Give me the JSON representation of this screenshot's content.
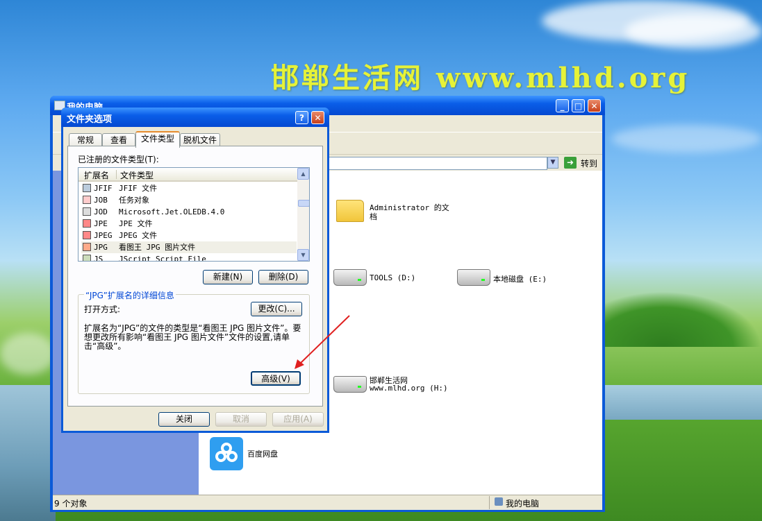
{
  "desktop": {
    "watermark": "邯郸生活网  www.mlhd.org",
    "side_labels": [
      "",
      "",
      "",
      ""
    ]
  },
  "main_window": {
    "title": "我的电脑",
    "address_go": "转到",
    "status_count": "9 个对象",
    "status_location": "我的电脑",
    "items": [
      {
        "name": "Administrator 的文档",
        "line1": "Administrator 的文",
        "line2": "档",
        "icon": "folder-icon"
      },
      {
        "name": "TOOLS (D:)",
        "line1": "TOOLS (D:)",
        "icon": "drive-icon"
      },
      {
        "name": "本地磁盘 (E:)",
        "line1": "本地磁盘 (E:)",
        "icon": "drive-icon"
      },
      {
        "name": "邯郸生活网 www.mlhd.org (H:)",
        "line1": "邯郸生活网",
        "line2": "www.mlhd.org (H:)",
        "icon": "drive-icon"
      },
      {
        "name": "百度网盘",
        "line1": "百度网盘",
        "icon": "baidu-icon"
      }
    ]
  },
  "dialog": {
    "title": "文件夹选项",
    "help_glyph": "?",
    "close_glyph": "✕",
    "tabs": [
      "常规",
      "查看",
      "文件类型",
      "脱机文件"
    ],
    "active_tab": "文件类型",
    "registered_label": "已注册的文件类型(T):",
    "columns": [
      "扩展名",
      "文件类型"
    ],
    "rows": [
      {
        "ext": "JFIF",
        "type": "JFIF 文件",
        "icon": "image-file-icon"
      },
      {
        "ext": "JOB",
        "type": "任务对象",
        "icon": "task-file-icon"
      },
      {
        "ext": "JOD",
        "type": "Microsoft.Jet.OLEDB.4.0",
        "icon": "db-file-icon"
      },
      {
        "ext": "JPE",
        "type": "JPE 文件",
        "icon": "picture-file-icon"
      },
      {
        "ext": "JPEG",
        "type": "JPEG 文件",
        "icon": "picture-file-icon"
      },
      {
        "ext": "JPG",
        "type": "看图王 JPG 图片文件",
        "icon": "viewer-file-icon"
      },
      {
        "ext": "JS",
        "type": "JScript Script File",
        "icon": "script-file-icon"
      }
    ],
    "selected_row": 5,
    "new_button": "新建(N)",
    "delete_button": "删除(D)",
    "details_group": "“JPG”扩展名的详细信息",
    "open_with_label": "打开方式:",
    "change_button": "更改(C)...",
    "description": "扩展名为“JPG”的文件的类型是“看图王 JPG 图片文件”。要想更改所有影响“看图王 JPG 图片文件”文件的设置,请单击“高级”。",
    "advanced_button": "高级(V)",
    "ok_button": "关闭",
    "cancel_button": "取消",
    "apply_button": "应用(A)"
  }
}
